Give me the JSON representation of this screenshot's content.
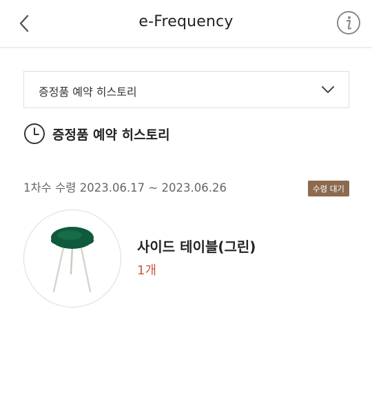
{
  "header": {
    "title": "e-Frequency",
    "back_icon": "chevron-left-icon",
    "info_icon": "info-circle-icon"
  },
  "filter": {
    "selected": "증정품 예약 히스토리",
    "icon": "chevron-down-icon"
  },
  "section": {
    "title": "증정품 예약 히스토리",
    "icon": "clock-icon"
  },
  "reservation": {
    "round_label": "1차수 수령 2023.06.17 ~ 2023.06.26",
    "status": "수령 대기",
    "status_color": "#8c6a4f",
    "product": {
      "name": "사이드 테이블(그린)",
      "quantity": "1개",
      "quantity_color": "#c9573e",
      "image": "green-side-table"
    }
  }
}
